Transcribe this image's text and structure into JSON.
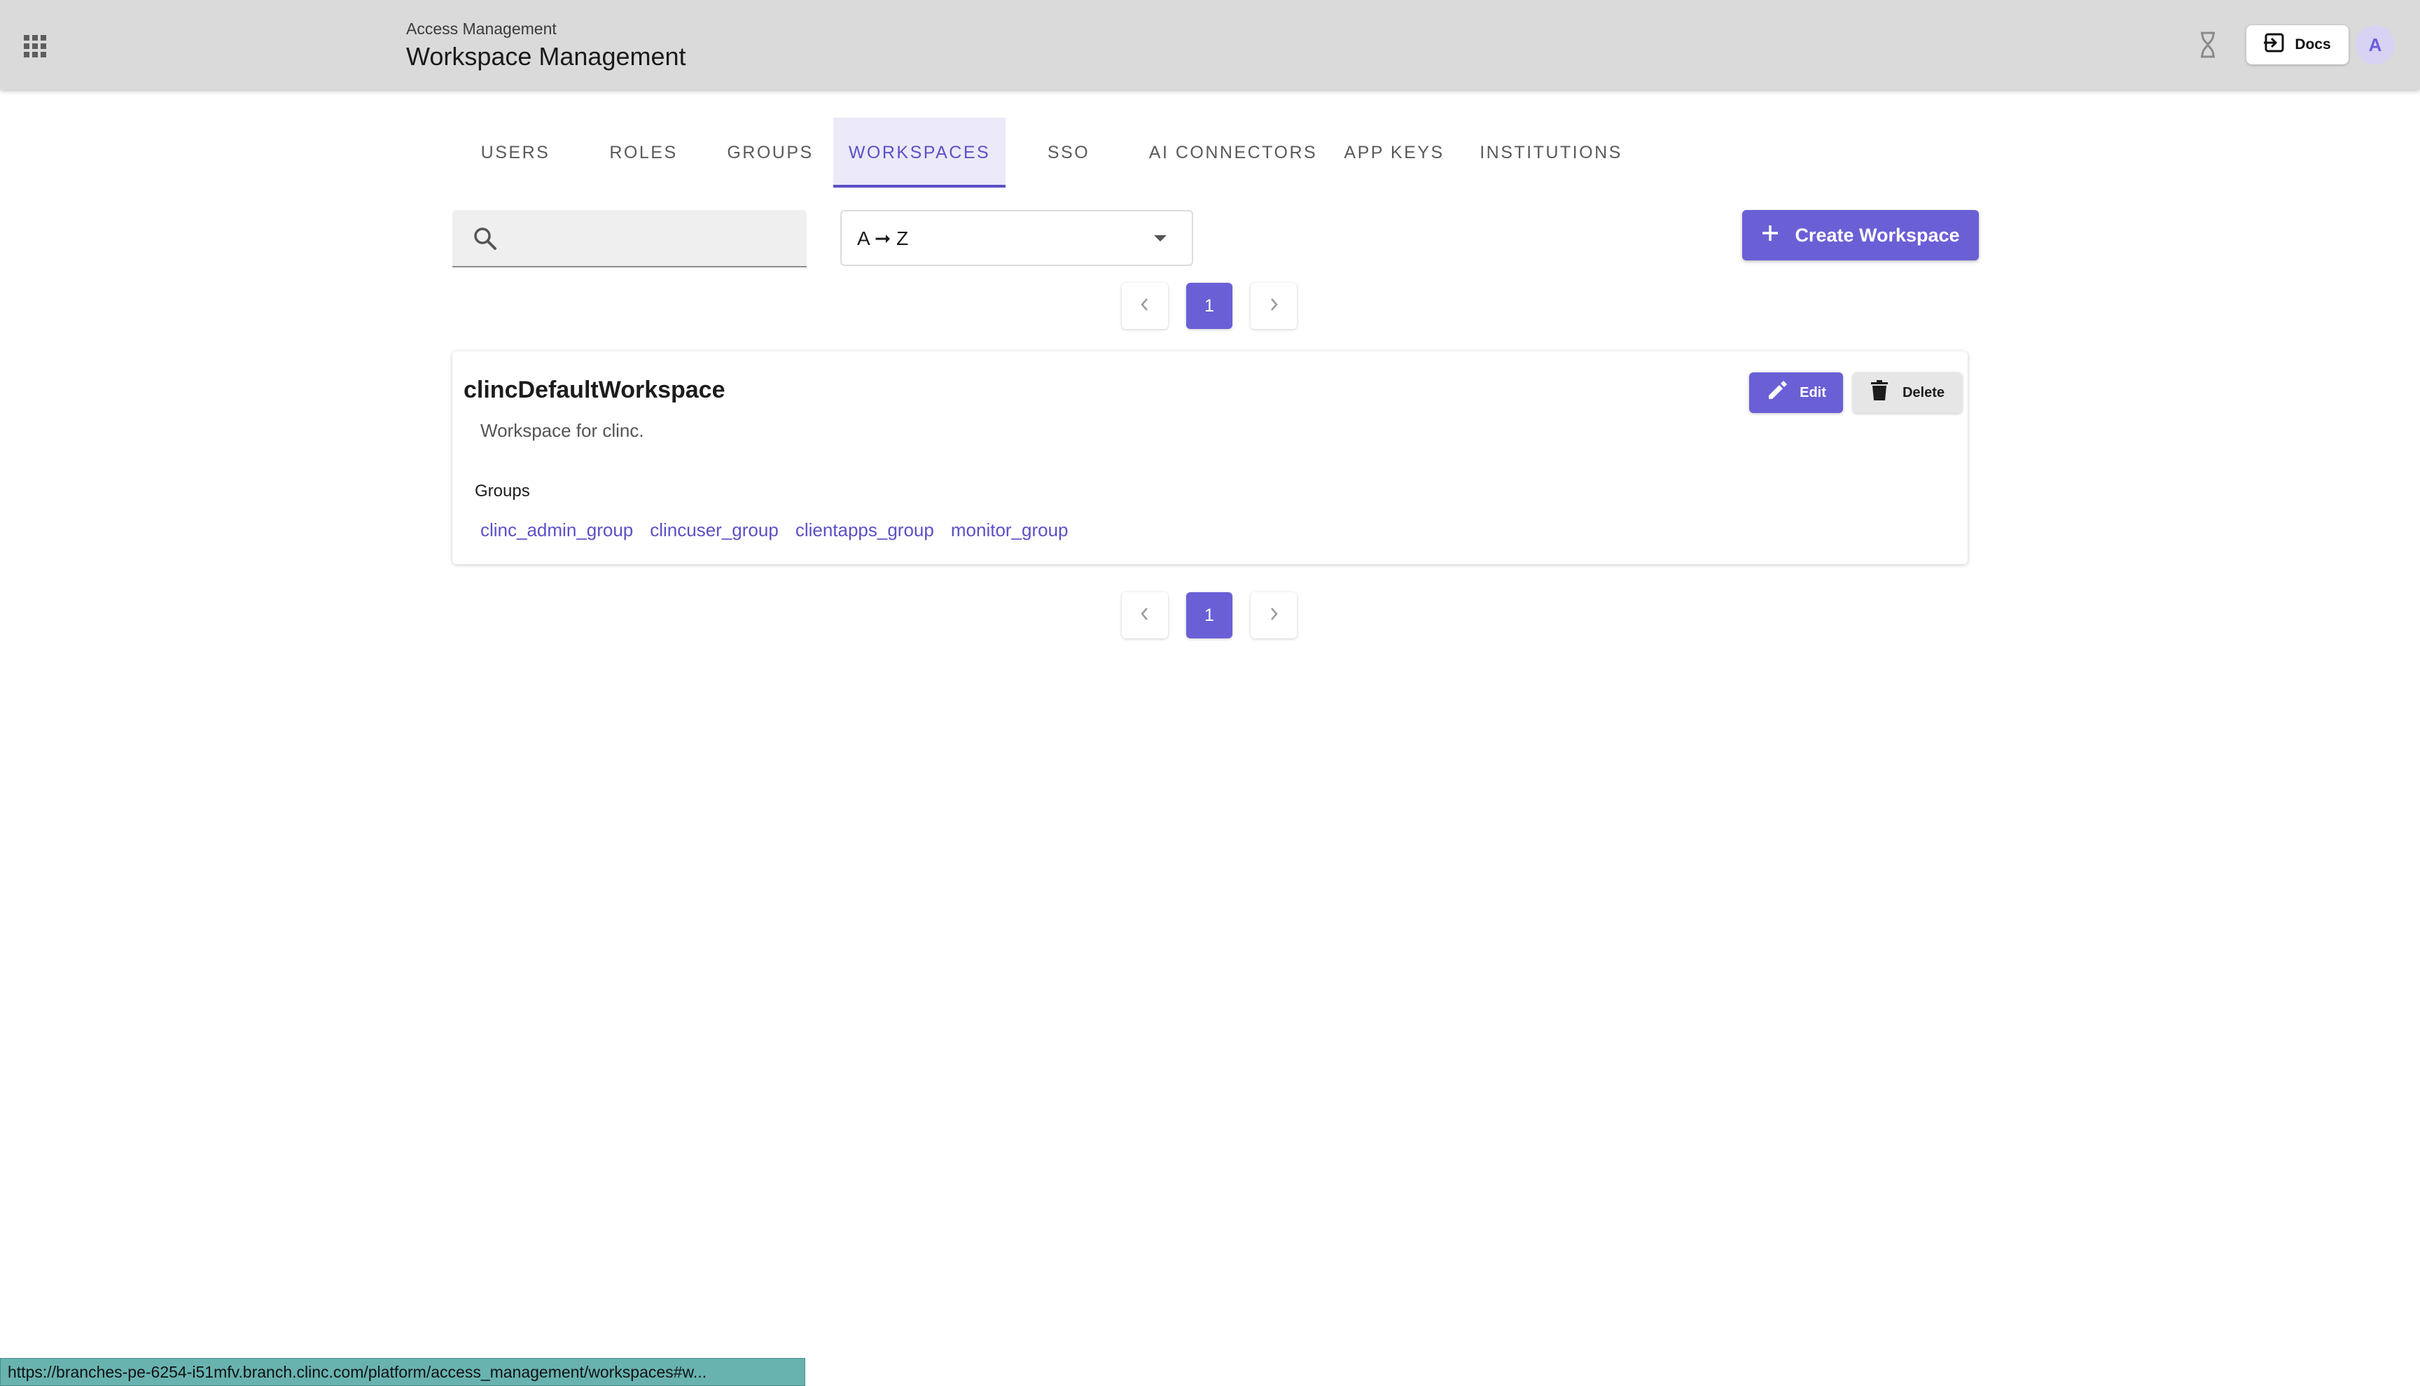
{
  "header": {
    "breadcrumb": "Access Management",
    "title": "Workspace Management",
    "docs_label": "Docs",
    "avatar_initial": "A"
  },
  "tabs": [
    {
      "label": "USERS",
      "active": false
    },
    {
      "label": "ROLES",
      "active": false
    },
    {
      "label": "GROUPS",
      "active": false
    },
    {
      "label": "WORKSPACES",
      "active": true
    },
    {
      "label": "SSO",
      "active": false
    },
    {
      "label": "AI CONNECTORS",
      "active": false
    },
    {
      "label": "APP KEYS",
      "active": false
    },
    {
      "label": "INSTITUTIONS",
      "active": false
    }
  ],
  "toolbar": {
    "search_value": "",
    "sort_value": "A ➞ Z",
    "create_label": "Create Workspace"
  },
  "pagination": {
    "current_page": "1"
  },
  "workspace": {
    "name": "clincDefaultWorkspace",
    "description": "Workspace for clinc.",
    "edit_label": "Edit",
    "delete_label": "Delete",
    "groups_label": "Groups",
    "groups": [
      "clinc_admin_group",
      "clincuser_group",
      "clientapps_group",
      "monitor_group"
    ]
  },
  "status_bar": {
    "url": "https://branches-pe-6254-i51mfv.branch.clinc.com/platform/access_management/workspaces#w..."
  },
  "colors": {
    "accent": "#6b5fd6",
    "header_bg": "#dadada",
    "active_tab_bg": "#ece9f9",
    "status_bar_bg": "#68b3b0"
  },
  "icons": [
    "apps-grid-icon",
    "hourglass-icon",
    "docs-login-icon",
    "search-icon",
    "sort-caret-icon",
    "plus-icon",
    "chevron-left-icon",
    "chevron-right-icon",
    "pencil-icon",
    "trash-icon"
  ]
}
